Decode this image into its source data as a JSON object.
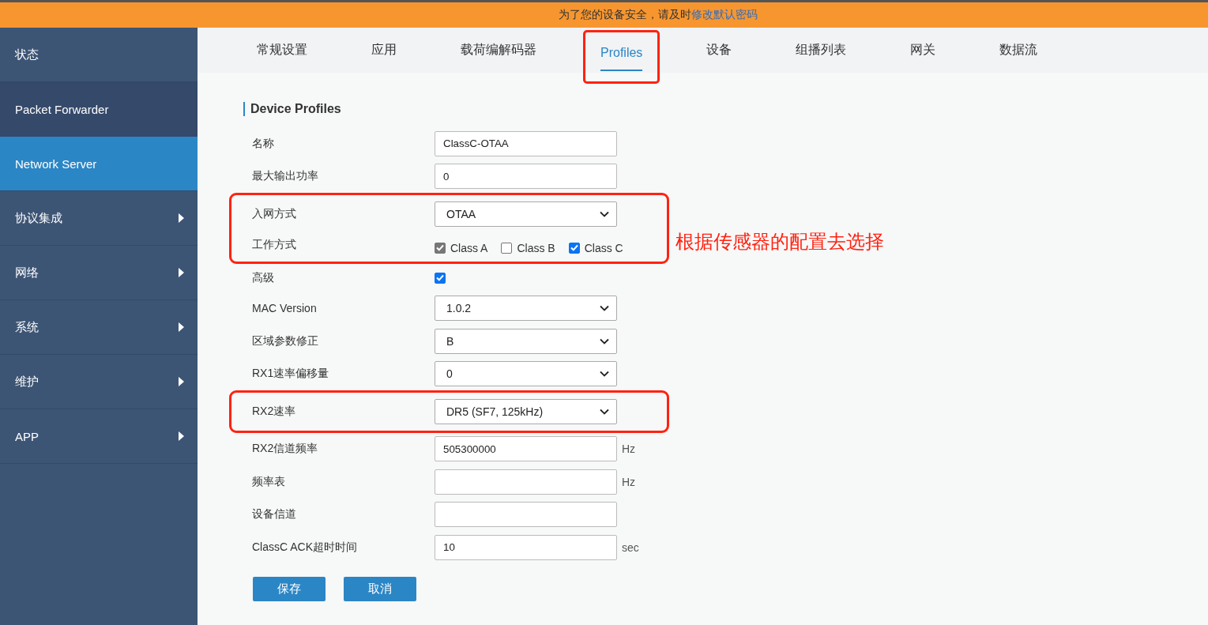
{
  "banner": {
    "text": "为了您的设备安全，请及时",
    "link": "修改默认密码"
  },
  "sidebar": {
    "items": [
      {
        "label": "状态",
        "selected": false,
        "hovered": false,
        "has_submenu": false
      },
      {
        "label": "Packet Forwarder",
        "selected": false,
        "hovered": true,
        "has_submenu": false
      },
      {
        "label": "Network Server",
        "selected": true,
        "hovered": false,
        "has_submenu": false
      },
      {
        "label": "协议集成",
        "selected": false,
        "hovered": false,
        "has_submenu": true
      },
      {
        "label": "网络",
        "selected": false,
        "hovered": false,
        "has_submenu": true
      },
      {
        "label": "系统",
        "selected": false,
        "hovered": false,
        "has_submenu": true
      },
      {
        "label": "维护",
        "selected": false,
        "hovered": false,
        "has_submenu": true
      },
      {
        "label": "APP",
        "selected": false,
        "hovered": false,
        "has_submenu": true
      }
    ]
  },
  "tabs": [
    {
      "label": "常规设置",
      "selected": false,
      "highlighted": false
    },
    {
      "label": "应用",
      "selected": false,
      "highlighted": false
    },
    {
      "label": "载荷编解码器",
      "selected": false,
      "highlighted": false
    },
    {
      "label": "Profiles",
      "selected": true,
      "highlighted": true
    },
    {
      "label": "设备",
      "selected": false,
      "highlighted": false
    },
    {
      "label": "组播列表",
      "selected": false,
      "highlighted": false
    },
    {
      "label": "网关",
      "selected": false,
      "highlighted": false
    },
    {
      "label": "数据流",
      "selected": false,
      "highlighted": false
    }
  ],
  "section_title": "Device Profiles",
  "groups": [
    {
      "highlighted": false,
      "rows": [
        {
          "kind": "text",
          "label": "名称",
          "value": "ClassC-OTAA"
        },
        {
          "kind": "text",
          "label": "最大输出功率",
          "value": "0"
        }
      ]
    },
    {
      "highlighted": true,
      "note": "根据传感器的配置去选择",
      "rows": [
        {
          "kind": "select",
          "label": "入网方式",
          "value": "OTAA"
        },
        {
          "kind": "checkboxes",
          "label": "工作方式",
          "options": [
            {
              "label": "Class A",
              "checked": true,
              "disabled": true
            },
            {
              "label": "Class B",
              "checked": false,
              "disabled": false
            },
            {
              "label": "Class C",
              "checked": true,
              "disabled": false
            }
          ]
        }
      ]
    },
    {
      "highlighted": false,
      "rows": [
        {
          "kind": "checkbox",
          "label": "高级",
          "checked": true
        },
        {
          "kind": "select",
          "label": "MAC Version",
          "value": "1.0.2"
        },
        {
          "kind": "select",
          "label": "区域参数修正",
          "value": "B"
        },
        {
          "kind": "select",
          "label": "RX1速率偏移量",
          "value": "0"
        }
      ]
    },
    {
      "highlighted": true,
      "rows": [
        {
          "kind": "select",
          "label": "RX2速率",
          "value": "DR5 (SF7, 125kHz)"
        }
      ]
    },
    {
      "highlighted": false,
      "rows": [
        {
          "kind": "text",
          "label": "RX2信道频率",
          "value": "505300000",
          "unit": "Hz"
        },
        {
          "kind": "text",
          "label": "频率表",
          "unit": "Hz"
        },
        {
          "kind": "text",
          "label": "设备信道"
        },
        {
          "kind": "text",
          "label": "ClassC ACK超时时间",
          "value": "10",
          "unit": "sec"
        }
      ]
    }
  ],
  "buttons": [
    {
      "label": "保存"
    },
    {
      "label": "取消"
    }
  ]
}
